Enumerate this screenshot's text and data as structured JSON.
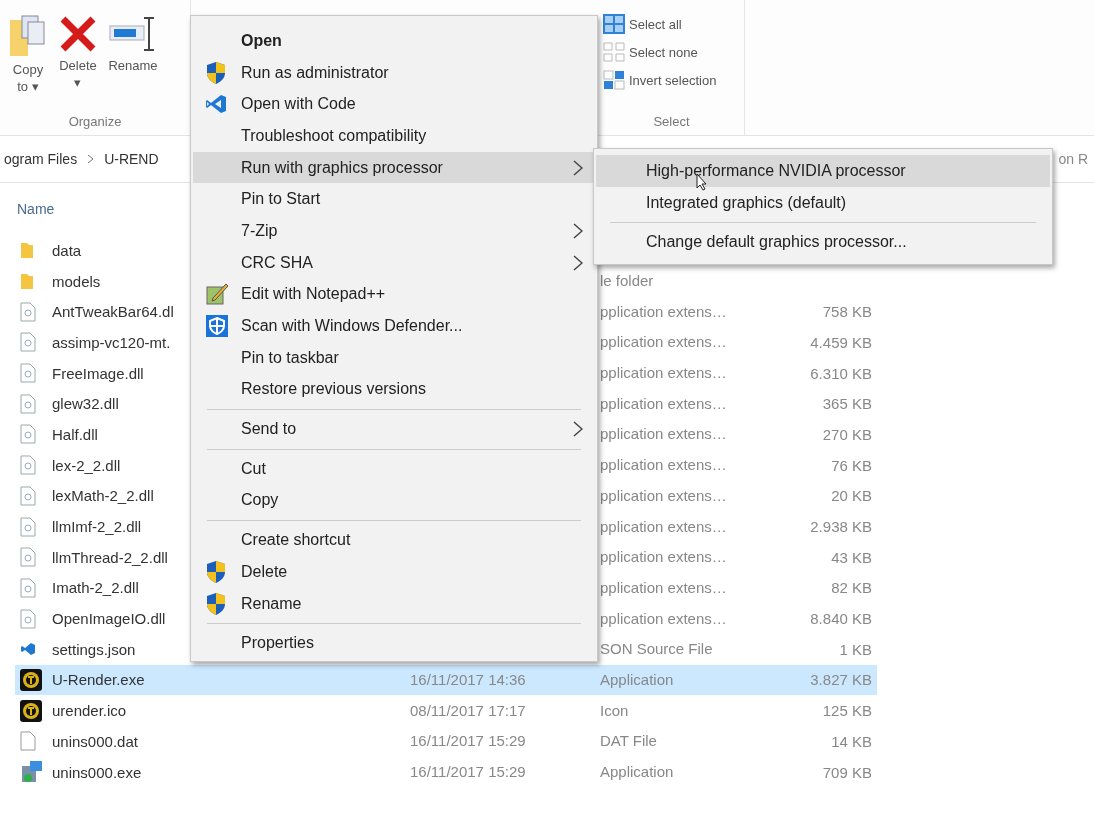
{
  "ribbon": {
    "groups": [
      {
        "label": "Organize",
        "buttons": [
          {
            "label": "Copy\nto ▾",
            "kind": "copy"
          },
          {
            "label": "Delete\n▾",
            "kind": "delete"
          },
          {
            "label": "Rename",
            "kind": "rename"
          }
        ]
      },
      {
        "label": "Select",
        "buttons": [
          {
            "label": "Select all",
            "kind": "all"
          },
          {
            "label": "Select none",
            "kind": "none"
          },
          {
            "label": "Invert selection",
            "kind": "invert"
          }
        ]
      }
    ]
  },
  "address_bar": {
    "crumbs": [
      "ogram Files",
      "U-REND"
    ],
    "search_field": {
      "placeholder": "on R"
    }
  },
  "file_list": {
    "columns": [
      "Name"
    ],
    "rows": [
      {
        "name": "data",
        "kind": "folder",
        "selected": false
      },
      {
        "name": "models",
        "kind": "folder",
        "type": "le folder",
        "selected": false
      },
      {
        "name": "AntTweakBar64.dl",
        "kind": "dll",
        "type": "pplication extens…",
        "size": "758 KB",
        "selected": false
      },
      {
        "name": "assimp-vc120-mt.",
        "kind": "dll",
        "type": "pplication extens…",
        "size": "4.459 KB",
        "selected": false
      },
      {
        "name": "FreeImage.dll",
        "kind": "dll",
        "type": "pplication extens…",
        "size": "6.310 KB",
        "selected": false
      },
      {
        "name": "glew32.dll",
        "kind": "dll",
        "type": "pplication extens…",
        "size": "365 KB",
        "selected": false
      },
      {
        "name": "Half.dll",
        "kind": "dll",
        "type": "pplication extens…",
        "size": "270 KB",
        "selected": false
      },
      {
        "name": "lex-2_2.dll",
        "kind": "dll",
        "type": "pplication extens…",
        "size": "76 KB",
        "selected": false
      },
      {
        "name": "lexMath-2_2.dll",
        "kind": "dll",
        "type": "pplication extens…",
        "size": "20 KB",
        "selected": false
      },
      {
        "name": "llmImf-2_2.dll",
        "kind": "dll",
        "type": "pplication extens…",
        "size": "2.938 KB",
        "selected": false
      },
      {
        "name": "llmThread-2_2.dll",
        "kind": "dll",
        "type": "pplication extens…",
        "size": "43 KB",
        "selected": false
      },
      {
        "name": "Imath-2_2.dll",
        "kind": "dll",
        "type": "pplication extens…",
        "size": "82 KB",
        "selected": false
      },
      {
        "name": "OpenImageIO.dll",
        "kind": "dll",
        "type": "pplication extens…",
        "size": "8.840 KB",
        "selected": false
      },
      {
        "name": "settings.json",
        "kind": "json",
        "type": "SON Source File",
        "size": "1 KB",
        "selected": false
      },
      {
        "name": "U-Render.exe",
        "kind": "app",
        "date": "16/11/2017 14:36",
        "type": "Application",
        "size": "3.827 KB",
        "selected": true
      },
      {
        "name": "urender.ico",
        "kind": "app",
        "date": "08/11/2017 17:17",
        "type": "Icon",
        "size": "125 KB",
        "selected": false
      },
      {
        "name": "unins000.dat",
        "kind": "blank",
        "date": "16/11/2017 15:29",
        "type": "DAT File",
        "size": "14 KB",
        "selected": false
      },
      {
        "name": "unins000.exe",
        "kind": "installer",
        "date": "16/11/2017 15:29",
        "type": "Application",
        "size": "709 KB",
        "selected": false
      }
    ]
  },
  "context_menu": {
    "items": [
      {
        "kind": "plain",
        "label": "Open",
        "default": true,
        "selected": false,
        "submenu": false
      },
      {
        "kind": "shield",
        "label": "Run as administrator",
        "default": false,
        "selected": false,
        "submenu": false
      },
      {
        "kind": "code",
        "label": "Open with Code",
        "default": false,
        "selected": false,
        "submenu": false
      },
      {
        "kind": "plain",
        "label": "Troubleshoot compatibility",
        "default": false,
        "selected": false,
        "submenu": false
      },
      {
        "kind": "plain",
        "label": "Run with graphics processor",
        "default": false,
        "selected": true,
        "submenu": true
      },
      {
        "kind": "plain",
        "label": "Pin to Start",
        "default": false,
        "selected": false,
        "submenu": false
      },
      {
        "kind": "plain",
        "label": "7-Zip",
        "default": false,
        "selected": false,
        "submenu": true
      },
      {
        "kind": "plain",
        "label": "CRC SHA",
        "default": false,
        "selected": false,
        "submenu": true
      },
      {
        "kind": "notepad",
        "label": "Edit with Notepad++",
        "default": false,
        "selected": false,
        "submenu": false
      },
      {
        "kind": "defender",
        "label": "Scan with Windows Defender...",
        "default": false,
        "selected": false,
        "submenu": false
      },
      {
        "kind": "plain",
        "label": "Pin to taskbar",
        "default": false,
        "selected": false,
        "submenu": false
      },
      {
        "kind": "plain",
        "label": "Restore previous versions",
        "default": false,
        "selected": false,
        "submenu": false
      },
      {
        "kind": "separator"
      },
      {
        "kind": "plain",
        "label": "Send to",
        "default": false,
        "selected": false,
        "submenu": true
      },
      {
        "kind": "separator"
      },
      {
        "kind": "plain",
        "label": "Cut",
        "default": false,
        "selected": false,
        "submenu": false
      },
      {
        "kind": "plain",
        "label": "Copy",
        "default": false,
        "selected": false,
        "submenu": false
      },
      {
        "kind": "separator"
      },
      {
        "kind": "plain",
        "label": "Create shortcut",
        "default": false,
        "selected": false,
        "submenu": false
      },
      {
        "kind": "shield",
        "label": "Delete",
        "default": false,
        "selected": false,
        "submenu": false
      },
      {
        "kind": "shield",
        "label": "Rename",
        "default": false,
        "selected": false,
        "submenu": false
      },
      {
        "kind": "separator"
      },
      {
        "kind": "plain",
        "label": "Properties",
        "default": false,
        "selected": false,
        "submenu": false
      }
    ]
  },
  "submenu": {
    "items": [
      {
        "kind": "item",
        "label": "High-performance NVIDIA processor",
        "selected": true
      },
      {
        "kind": "item",
        "label": "Integrated graphics (default)",
        "selected": false
      },
      {
        "kind": "separator"
      },
      {
        "kind": "item",
        "label": "Change default graphics processor...",
        "selected": false
      }
    ]
  }
}
